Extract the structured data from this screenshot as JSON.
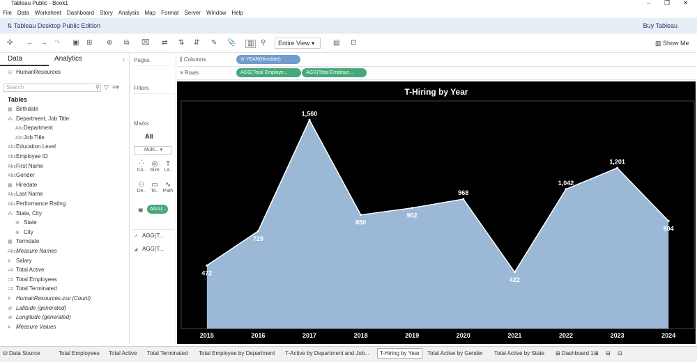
{
  "window": {
    "title": "Tableau Public - Book1",
    "controls": [
      "–",
      "❐",
      "✕"
    ]
  },
  "menu": [
    "File",
    "Data",
    "Worksheet",
    "Dashboard",
    "Story",
    "Analysis",
    "Map",
    "Format",
    "Server",
    "Window",
    "Help"
  ],
  "banner": {
    "edition": "Tableau Desktop Public Edition",
    "buy": "Buy Tableau"
  },
  "toolbar": {
    "fit": "Entire View",
    "show_me": "Show Me"
  },
  "data_pane": {
    "tab_data": "Data",
    "tab_analytics": "Analytics",
    "source": "HumanResources",
    "search_placeholder": "Search",
    "tables_header": "Tables",
    "fields": [
      {
        "label": "Birthdate",
        "icon": "calendar-icon",
        "glyph": "▦",
        "indent": 0,
        "italic": false
      },
      {
        "label": "Department, Job Title",
        "icon": "hierarchy-icon",
        "glyph": "⁂",
        "indent": 0,
        "italic": false
      },
      {
        "label": "Department",
        "icon": "abc-icon",
        "glyph": "Abc",
        "indent": 1,
        "italic": false
      },
      {
        "label": "Job Title",
        "icon": "abc-icon",
        "glyph": "Abc",
        "indent": 1,
        "italic": false
      },
      {
        "label": "Education Level",
        "icon": "abc-icon",
        "glyph": "Abc",
        "indent": 0,
        "italic": false
      },
      {
        "label": "Employee ID",
        "icon": "abc-icon",
        "glyph": "Abc",
        "indent": 0,
        "italic": false
      },
      {
        "label": "First Name",
        "icon": "abc-icon",
        "glyph": "Abc",
        "indent": 0,
        "italic": false
      },
      {
        "label": "Gender",
        "icon": "abc-icon",
        "glyph": "Abc",
        "indent": 0,
        "italic": false
      },
      {
        "label": "Hiredate",
        "icon": "calendar-icon",
        "glyph": "▦",
        "indent": 0,
        "italic": false
      },
      {
        "label": "Last Name",
        "icon": "abc-icon",
        "glyph": "Abc",
        "indent": 0,
        "italic": false
      },
      {
        "label": "Performance Rating",
        "icon": "abc-icon",
        "glyph": "Abc",
        "indent": 0,
        "italic": false
      },
      {
        "label": "State, City",
        "icon": "hierarchy-icon",
        "glyph": "⁂",
        "indent": 0,
        "italic": false
      },
      {
        "label": "State",
        "icon": "globe-icon",
        "glyph": "⊕",
        "indent": 1,
        "italic": false
      },
      {
        "label": "City",
        "icon": "globe-icon",
        "glyph": "⊕",
        "indent": 1,
        "italic": false
      },
      {
        "label": "Termdate",
        "icon": "calendar-icon",
        "glyph": "▦",
        "indent": 0,
        "italic": false
      },
      {
        "label": "Measure Names",
        "icon": "abc-icon",
        "glyph": "Abc",
        "indent": 0,
        "italic": true
      },
      {
        "label": "Salary",
        "icon": "measure-icon",
        "glyph": "#",
        "indent": 0,
        "italic": false
      },
      {
        "label": "Total Active",
        "icon": "measure-icon",
        "glyph": "=#",
        "indent": 0,
        "italic": false
      },
      {
        "label": "Total Employees",
        "icon": "measure-icon",
        "glyph": "=#",
        "indent": 0,
        "italic": false
      },
      {
        "label": "Total Terminated",
        "icon": "measure-icon",
        "glyph": "=#",
        "indent": 0,
        "italic": false
      },
      {
        "label": "HumanResources.csv (Count)",
        "icon": "measure-icon",
        "glyph": "#",
        "indent": 0,
        "italic": true
      },
      {
        "label": "Latitude (generated)",
        "icon": "globe-icon",
        "glyph": "⊕",
        "indent": 0,
        "italic": true
      },
      {
        "label": "Longitude (generated)",
        "icon": "globe-icon",
        "glyph": "⊕",
        "indent": 0,
        "italic": true
      },
      {
        "label": "Measure Values",
        "icon": "measure-icon",
        "glyph": "#",
        "indent": 0,
        "italic": true
      }
    ]
  },
  "cards": {
    "pages": "Pages",
    "filters": "Filters",
    "marks": "Marks",
    "all": "All",
    "mark_type": "Multi...",
    "buttons": [
      {
        "label": "Co..",
        "icon": "color-icon",
        "glyph": "⁛"
      },
      {
        "label": "Size",
        "icon": "size-icon",
        "glyph": "◎"
      },
      {
        "label": "La..",
        "icon": "label-icon",
        "glyph": "T"
      },
      {
        "label": "De..",
        "icon": "detail-icon",
        "glyph": "⚇"
      },
      {
        "label": "To..",
        "icon": "tooltip-icon",
        "glyph": "▭"
      },
      {
        "label": "Path",
        "icon": "path-icon",
        "glyph": "∿"
      }
    ],
    "mark_pill": "AGG(...",
    "measure_a": "AGG(T...",
    "measure_b": "AGG(T..."
  },
  "shelves": {
    "columns_label": "Columns",
    "rows_label": "Rows",
    "columns_pill": "YEAR(Hiredate)",
    "rows_pill_1": "AGG(Total Employe...",
    "rows_pill_2": "AGG(Total Employe..."
  },
  "chart_data": {
    "type": "area",
    "title": "T-Hiring by Year",
    "x": [
      "2015",
      "2016",
      "2017",
      "2018",
      "2019",
      "2020",
      "2021",
      "2022",
      "2023",
      "2024"
    ],
    "values": [
      472,
      729,
      1560,
      850,
      902,
      968,
      422,
      1042,
      1201,
      804
    ],
    "labels": [
      "472",
      "729",
      "1,560",
      "850",
      "902",
      "968",
      "422",
      "1,042",
      "1,201",
      "804"
    ],
    "ylim": [
      0,
      1650
    ],
    "background": "#000000",
    "fill": "#9bb8d6",
    "line": "#ffffff"
  },
  "sheet_tabs": [
    {
      "label": "Data Source",
      "active": false
    },
    {
      "label": "Total Employees",
      "active": false
    },
    {
      "label": "Total Active",
      "active": false
    },
    {
      "label": "Total Terminated",
      "active": false
    },
    {
      "label": "Total Employee by Department",
      "active": false
    },
    {
      "label": "T-Active by Department and Job...",
      "active": false
    },
    {
      "label": "T-Hiring by Year",
      "active": true
    },
    {
      "label": "Total Active by Gender",
      "active": false
    },
    {
      "label": "Total Active by State",
      "active": false
    },
    {
      "label": "Dashboard 1",
      "active": false
    }
  ]
}
